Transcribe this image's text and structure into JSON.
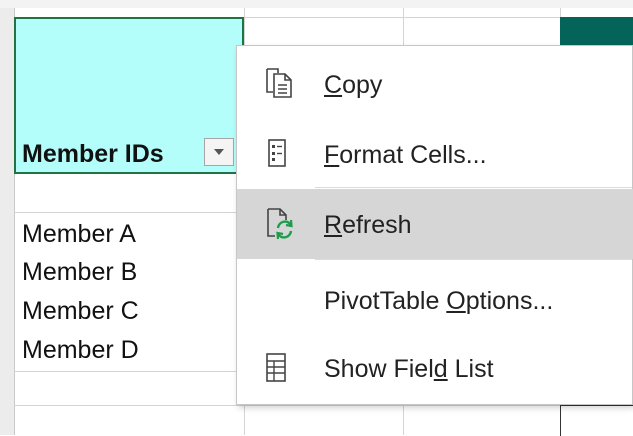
{
  "sheet": {
    "header_label": "Member IDs",
    "members": [
      "Member A",
      "Member B",
      "Member C",
      "Member D"
    ],
    "header_fill_color": "#b3fefb",
    "accent_color": "#05645a"
  },
  "context_menu": {
    "items": [
      {
        "label": "Copy",
        "icon": "copy-icon",
        "hotkey_index": 0
      },
      {
        "label": "Format Cells...",
        "icon": "format-cells-icon",
        "hotkey_index": 0
      },
      {
        "label": "Refresh",
        "icon": "refresh-icon",
        "hotkey_index": 0,
        "highlighted": true
      },
      {
        "label": "PivotTable Options...",
        "icon": "",
        "hotkey_index": 11
      },
      {
        "label": "Show Field List",
        "icon": "field-list-icon",
        "hotkey_index": 9
      }
    ]
  }
}
